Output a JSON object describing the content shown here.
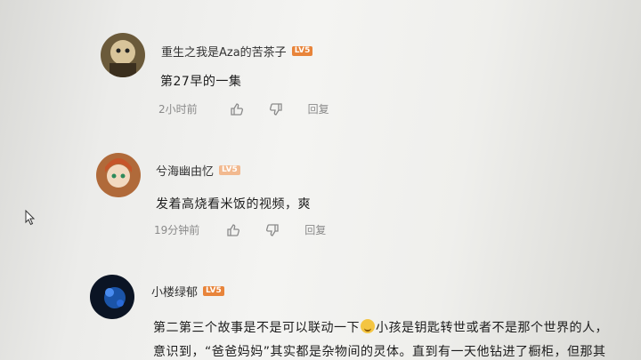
{
  "comments": [
    {
      "username": "重生之我是Aza的苦茶子",
      "level": "LV5",
      "content": "第27早的一集",
      "time": "2小时前",
      "reply_label": "回复"
    },
    {
      "username": "兮海幽由忆",
      "level": "LV5",
      "content": "发着高烧看米饭的视频，爽",
      "time": "19分钟前",
      "reply_label": "回复"
    },
    {
      "username": "小楼绿郁",
      "level": "LV5",
      "content_line1_a": "第二第三个故事是不是可以联动一下",
      "content_line1_b": "小孩是钥匙转世或者不是那个世界的人，",
      "content_line2": "意识到，“爸爸妈妈”其实都是杂物间的灵体。直到有一天他钻进了橱柜，但那其"
    }
  ],
  "icons": {
    "like": "thumbs-up-icon",
    "dislike": "thumbs-down-icon",
    "cursor": "mouse-pointer-icon",
    "emoji": "laughing-emoji-icon"
  },
  "colors": {
    "level_badge": "#e8843a",
    "meta_text": "#8a8a8a",
    "content_text": "#1c1c1c"
  }
}
